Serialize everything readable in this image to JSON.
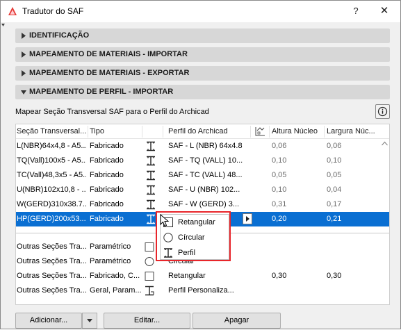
{
  "window": {
    "title": "Tradutor do SAF",
    "help_symbol": "?",
    "close_symbol": "✕"
  },
  "sections": [
    {
      "label": "IDENTIFICAÇÃO",
      "expanded": false
    },
    {
      "label": "MAPEAMENTO DE MATERIAIS - IMPORTAR",
      "expanded": false
    },
    {
      "label": "MAPEAMENTO DE MATERIAIS - EXPORTAR",
      "expanded": false
    },
    {
      "label": "MAPEAMENTO DE PERFIL - IMPORTAR",
      "expanded": true
    }
  ],
  "description": "Mapear Seção Transversal SAF para o Perfil do Archicad",
  "table": {
    "headers": {
      "section": "Seção Transversal...",
      "type": "Tipo",
      "profile": "Perfil do Archicad",
      "height": "Altura Núcleo",
      "width": "Largura Núc..."
    },
    "rows": [
      {
        "section": "L(NBR)64x4,8 - A5...",
        "type": "Fabricado",
        "profile": "SAF - L (NBR) 64x4.8",
        "height": "0,06",
        "width": "0,06"
      },
      {
        "section": "TQ(Vall)100x5 - A5...",
        "type": "Fabricado",
        "profile": "SAF - TQ (VALL) 10...",
        "height": "0,10",
        "width": "0,10"
      },
      {
        "section": "TC(Vall)48,3x5 - A5...",
        "type": "Fabricado",
        "profile": "SAF - TC (VALL) 48...",
        "height": "0,05",
        "width": "0,05"
      },
      {
        "section": "U(NBR)102x10,8 - ...",
        "type": "Fabricado",
        "profile": "SAF - U (NBR) 102...",
        "height": "0,10",
        "width": "0,04"
      },
      {
        "section": "W(GERD)310x38.7...",
        "type": "Fabricado",
        "profile": "SAF - W (GERD) 3...",
        "height": "0,31",
        "width": "0,17"
      },
      {
        "section": "HP(GERD)200x53....",
        "type": "Fabricado",
        "profile": "",
        "height": "0,20",
        "width": "0,21"
      }
    ],
    "other_rows": [
      {
        "section": "Outras Seções Tra...",
        "type": "Paramétrico",
        "profile": "",
        "height": "",
        "width": ""
      },
      {
        "section": "Outras Seções Tra...",
        "type": "Paramétrico",
        "profile": "Circular",
        "height": "",
        "width": ""
      },
      {
        "section": "Outras Seções Tra...",
        "type": "Fabricado, C...",
        "profile": "Retangular",
        "height": "0,30",
        "width": "0,30"
      },
      {
        "section": "Outras Seções Tra...",
        "type": "Geral, Param...",
        "profile": "Perfil Personaliza...",
        "height": "",
        "width": ""
      }
    ]
  },
  "shape_popup": {
    "items": [
      {
        "label": "Retangular",
        "icon": "rectangle-icon"
      },
      {
        "label": "Círcular",
        "icon": "circle-icon"
      },
      {
        "label": "Perfil",
        "icon": "i-beam-icon"
      }
    ]
  },
  "buttons": {
    "add": "Adicionar...",
    "edit": "Editar...",
    "delete": "Apagar"
  },
  "colors": {
    "selection": "#0a6fd2",
    "highlight_border": "#e8252a",
    "section_bg": "#d7d7d7"
  }
}
